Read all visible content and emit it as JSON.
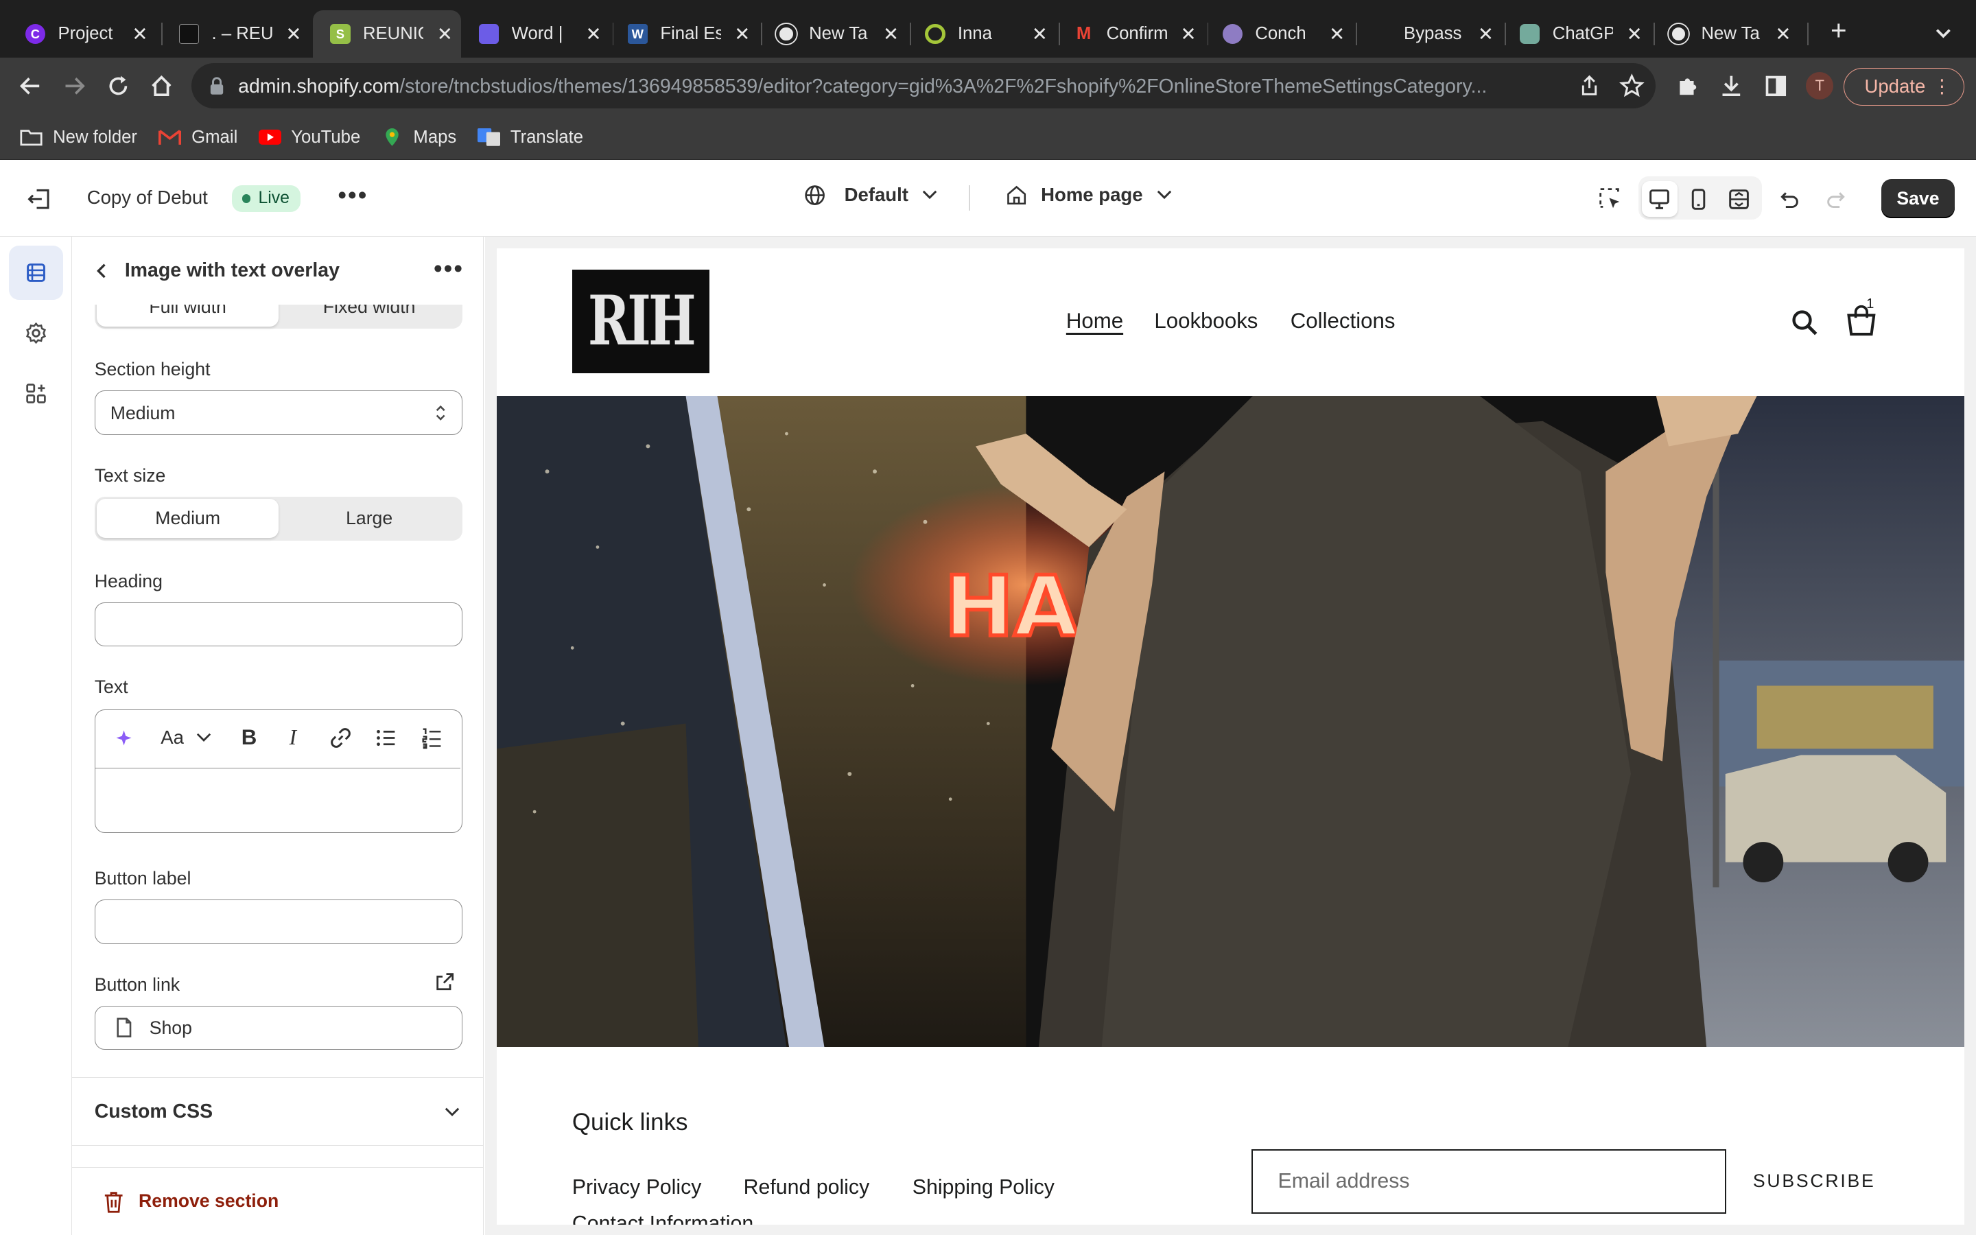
{
  "browser": {
    "tabs": [
      {
        "title": "Project",
        "icon": "canva-icon",
        "color": "#7d2ae8"
      },
      {
        "title": ". – REU",
        "icon": "rih-logo-icon",
        "color": "#111111"
      },
      {
        "title": "REUNIO",
        "icon": "shopify-icon",
        "color": "#95bf47",
        "active": true
      },
      {
        "title": "Word |",
        "icon": "app-icon",
        "color": "#6c5ce7"
      },
      {
        "title": "Final Es",
        "icon": "word-icon",
        "color": "#2b579a"
      },
      {
        "title": "New Ta",
        "icon": "chrome-icon",
        "color": "#e8e8e8"
      },
      {
        "title": "Inna",
        "icon": "target-icon",
        "color": "#a4c639"
      },
      {
        "title": "Confirm",
        "icon": "gmail-icon",
        "color": "#ea4335"
      },
      {
        "title": "Conch",
        "icon": "conch-icon",
        "color": "#8e7cc3"
      },
      {
        "title": "Bypass",
        "icon": "blank-icon",
        "color": "#1f1f1f"
      },
      {
        "title": "ChatGP",
        "icon": "chatgpt-icon",
        "color": "#74aa9c"
      },
      {
        "title": "New Ta",
        "icon": "chrome-icon",
        "color": "#e8e8e8"
      }
    ],
    "url_domain": "admin.shopify.com",
    "url_path": "/store/tncbstudios/themes/136949858539/editor?category=gid%3A%2F%2Fshopify%2FOnlineStoreThemeSettingsCategory...",
    "profile_initial": "T",
    "update_label": "Update",
    "bookmarks": [
      {
        "label": "New folder",
        "icon": "folder-icon"
      },
      {
        "label": "Gmail",
        "icon": "gmail-icon"
      },
      {
        "label": "YouTube",
        "icon": "youtube-icon"
      },
      {
        "label": "Maps",
        "icon": "maps-icon"
      },
      {
        "label": "Translate",
        "icon": "translate-icon"
      }
    ]
  },
  "editor": {
    "theme_name": "Copy of Debut",
    "live_badge": "Live",
    "locale_select": "Default",
    "page_select": "Home page",
    "save_label": "Save"
  },
  "panel": {
    "title": "Image with text overlay",
    "width_options": [
      "Full width",
      "Fixed width"
    ],
    "section_height_label": "Section height",
    "section_height_value": "Medium",
    "text_size_label": "Text size",
    "text_size_options": [
      "Medium",
      "Large"
    ],
    "heading_label": "Heading",
    "heading_value": "",
    "text_label": "Text",
    "text_format_label": "Aa",
    "button_label_label": "Button label",
    "button_label_value": "",
    "button_link_label": "Button link",
    "button_link_value": "Shop",
    "custom_css_label": "Custom CSS",
    "remove_label": "Remove section"
  },
  "store": {
    "logo_text": "RIH",
    "nav": [
      "Home",
      "Lookbooks",
      "Collections"
    ],
    "cart_count": "1",
    "hero_sign_text": "HA",
    "footer_title": "Quick links",
    "footer_links": [
      "Privacy Policy",
      "Refund policy",
      "Shipping Policy"
    ],
    "footer_link_partial": "Contact Information",
    "email_placeholder": "Email address",
    "subscribe_label": "SUBSCRIBE"
  }
}
